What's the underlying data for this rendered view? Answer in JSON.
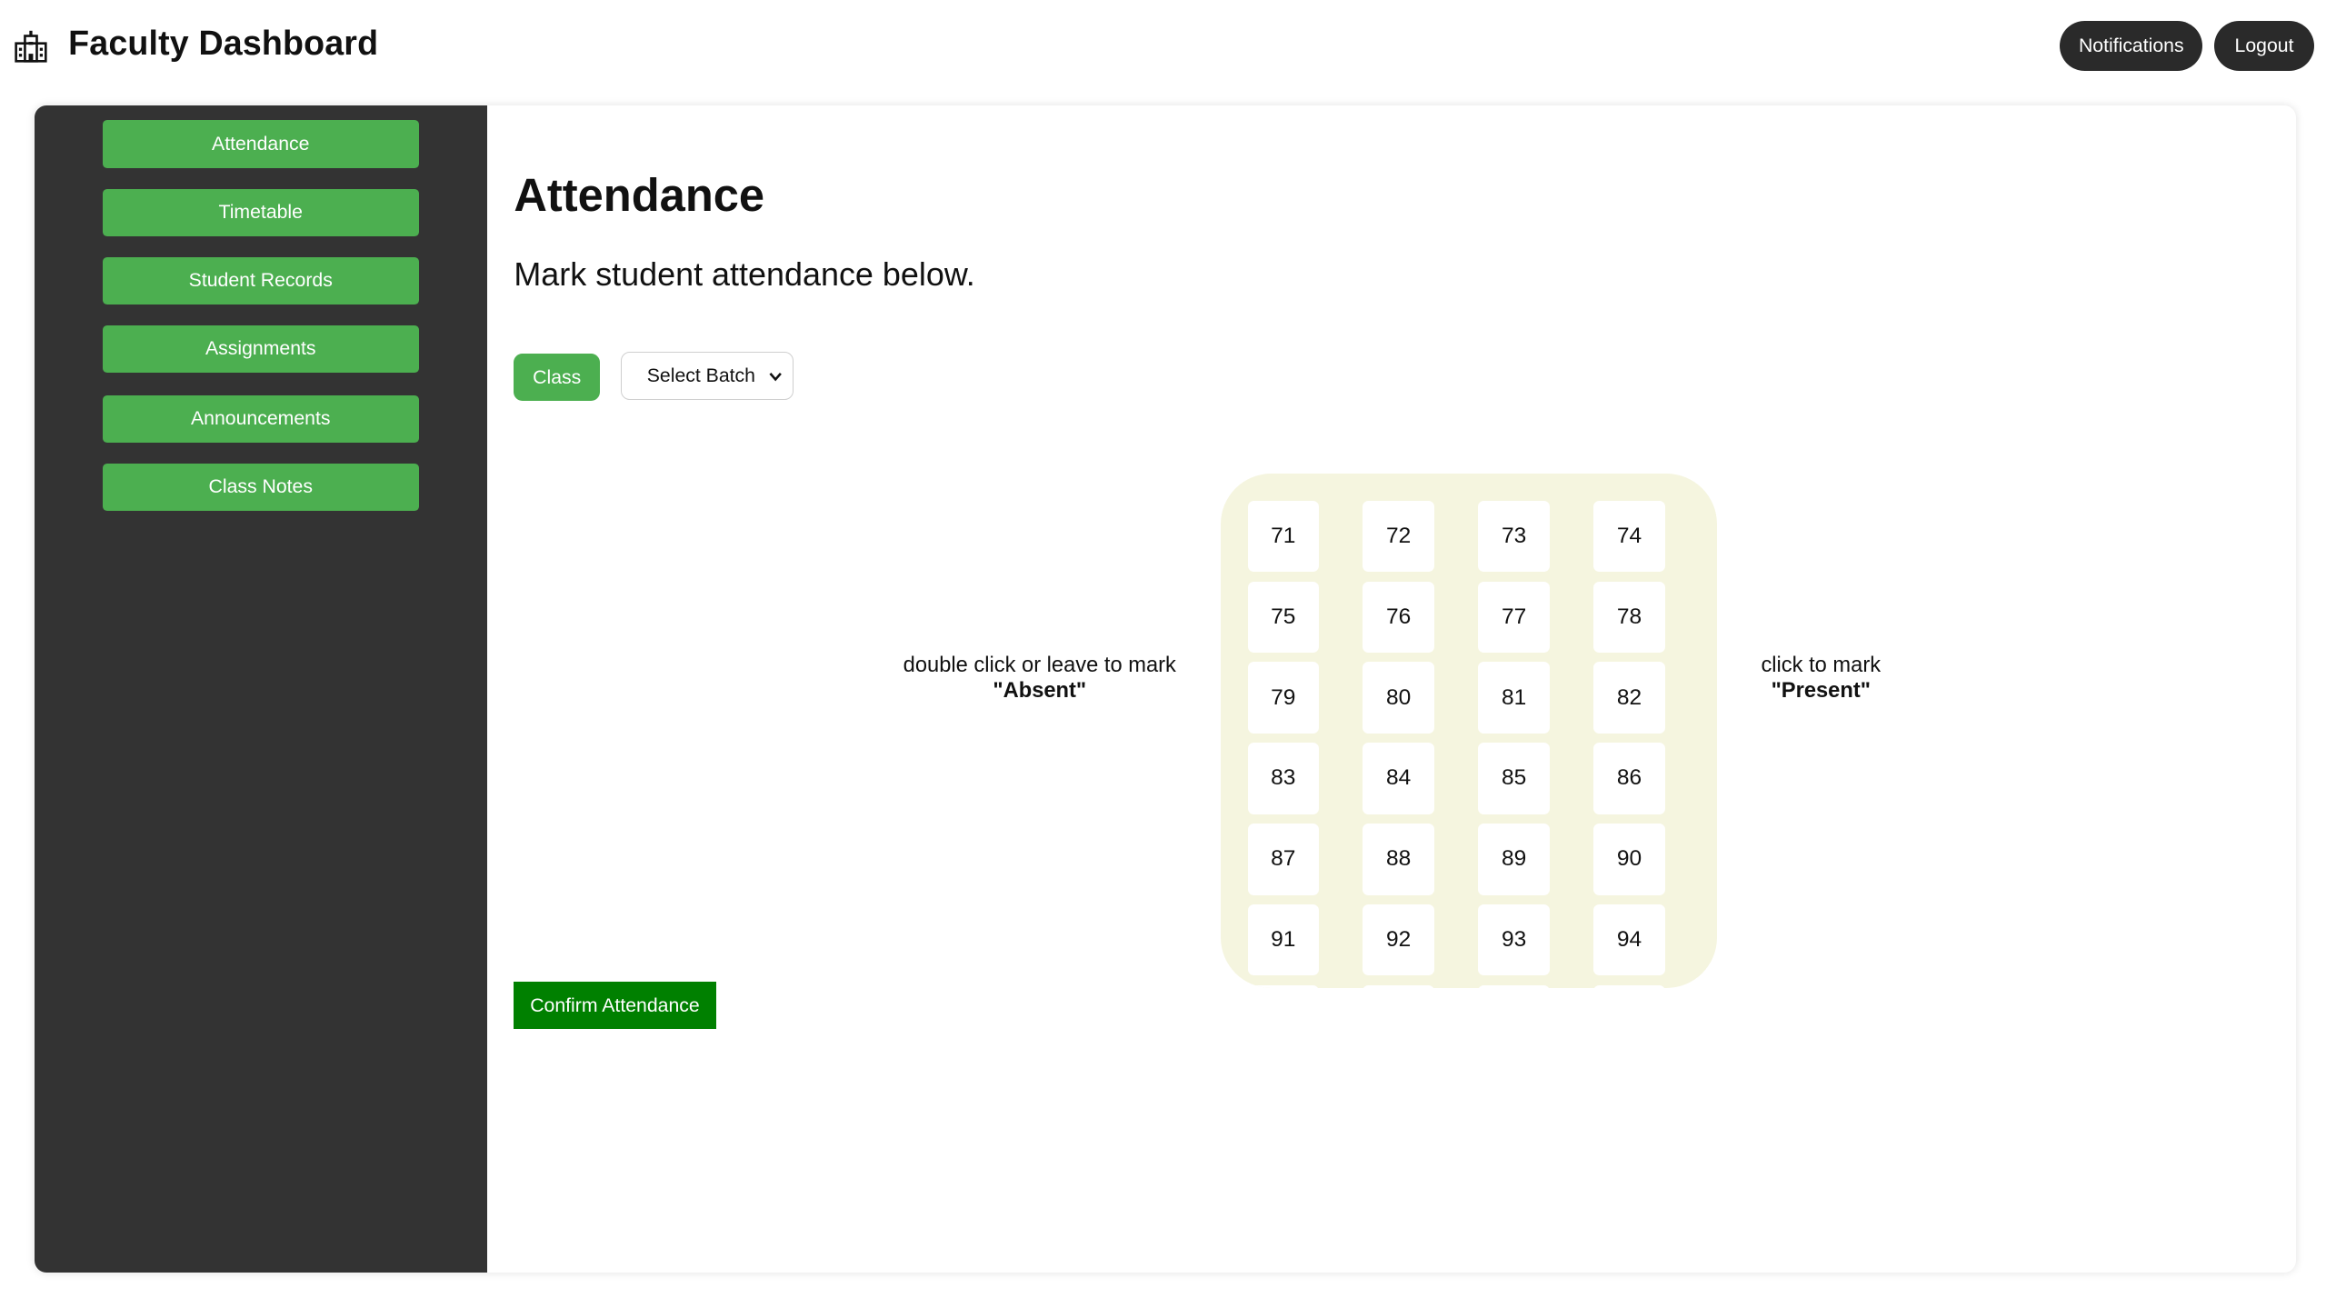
{
  "header": {
    "logo_icon": "building-icon",
    "title": "Faculty Dashboard",
    "notifications_label": "Notifications",
    "logout_label": "Logout"
  },
  "sidebar": {
    "items": [
      {
        "label": "Attendance"
      },
      {
        "label": "Timetable"
      },
      {
        "label": "Student Records"
      },
      {
        "label": "Assignments"
      },
      {
        "label": "Announcements"
      },
      {
        "label": "Class Notes"
      }
    ]
  },
  "main": {
    "title": "Attendance",
    "subtitle": "Mark student attendance below.",
    "class_button": "Class",
    "batch_select": {
      "selected": "Select Batch"
    },
    "hint_absent_prefix": "double click or leave to mark",
    "hint_absent_value": "\"Absent\"",
    "hint_present_prefix": "click to mark",
    "hint_present_value": "\"Present\"",
    "roll_numbers": [
      "71",
      "72",
      "73",
      "74",
      "75",
      "76",
      "77",
      "78",
      "79",
      "80",
      "81",
      "82",
      "83",
      "84",
      "85",
      "86",
      "87",
      "88",
      "89",
      "90",
      "91",
      "92",
      "93",
      "94"
    ],
    "confirm_button": "Confirm Attendance"
  },
  "colors": {
    "accent_green": "#4caf50",
    "confirm_green": "#008000",
    "sidebar_bg": "#333333",
    "grid_bg": "#f5f5df",
    "pill_bg": "#2a2a2a"
  }
}
